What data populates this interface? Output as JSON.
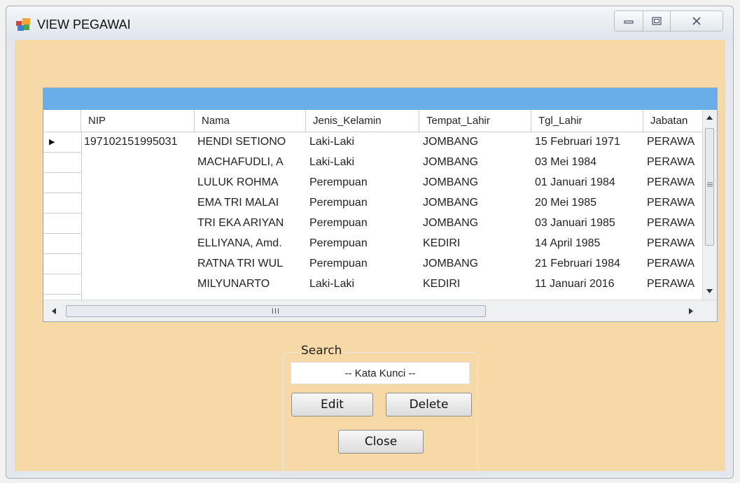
{
  "window": {
    "title": "VIEW PEGAWAI"
  },
  "grid": {
    "columns": [
      "NIP",
      "Nama",
      "Jenis_Kelamin",
      "Tempat_Lahir",
      "Tgl_Lahir",
      "Jabatan"
    ],
    "rows": [
      [
        "197102151995031",
        "HENDI SETIONO",
        "Laki-Laki",
        "JOMBANG",
        "15 Februari 1971",
        "PERAWA"
      ],
      [
        "",
        "MACHAFUDLI, A",
        "Laki-Laki",
        "JOMBANG",
        "03 Mei 1984",
        "PERAWA"
      ],
      [
        "",
        "LULUK ROHMA",
        "Perempuan",
        "JOMBANG",
        "01 Januari 1984",
        "PERAWA"
      ],
      [
        "",
        "EMA TRI MALAI",
        "Perempuan",
        "JOMBANG",
        "20 Mei 1985",
        "PERAWA"
      ],
      [
        "",
        "TRI EKA ARIYAN",
        "Perempuan",
        "JOMBANG",
        "03 Januari 1985",
        "PERAWA"
      ],
      [
        "",
        "ELLIYANA, Amd.",
        "Perempuan",
        "KEDIRI",
        "14 April 1985",
        "PERAWA"
      ],
      [
        "",
        "RATNA TRI WUL",
        "Perempuan",
        "JOMBANG",
        "21 Februari 1984",
        "PERAWA"
      ],
      [
        "",
        "MILYUNARTO",
        "Laki-Laki",
        "KEDIRI",
        "11 Januari 2016",
        "PERAWA"
      ]
    ],
    "current_row_marker": "▶",
    "hscroll_grip": "III"
  },
  "search": {
    "group_label": "Search",
    "input_value": "-- Kata Kunci --"
  },
  "buttons": {
    "edit": "Edit",
    "delete": "Delete",
    "close": "Close"
  },
  "colors": {
    "form_background": "#f6d9a7",
    "grid_band": "#6aaee8"
  }
}
